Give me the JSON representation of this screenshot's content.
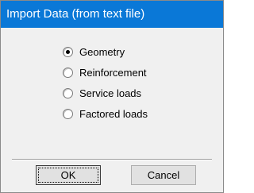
{
  "dialog": {
    "title": "Import Data (from text file)"
  },
  "options": [
    {
      "label": "Geometry",
      "selected": true
    },
    {
      "label": "Reinforcement",
      "selected": false
    },
    {
      "label": "Service loads",
      "selected": false
    },
    {
      "label": "Factored loads",
      "selected": false
    }
  ],
  "buttons": {
    "ok_label": "OK",
    "cancel_label": "Cancel"
  }
}
